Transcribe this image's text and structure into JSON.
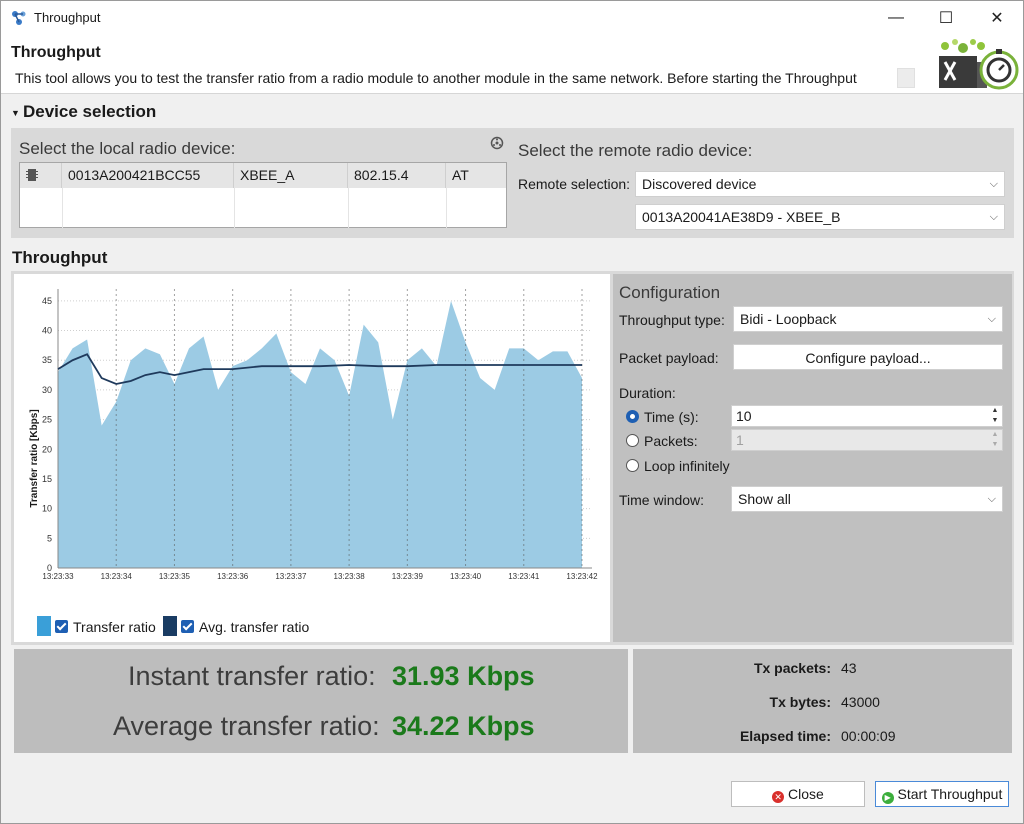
{
  "window": {
    "title": "Throughput",
    "minimize": "—",
    "maximize": "☐",
    "close": "✕"
  },
  "header": {
    "title": "Throughput",
    "description": "This tool allows you to test the transfer ratio from a radio module to another module in the same network. Before starting the Throughput"
  },
  "device_selection": {
    "section_title": "Device selection",
    "local_label": "Select the local radio device:",
    "local_device": {
      "mac": "0013A200421BCC55",
      "name": "XBEE_A",
      "protocol": "802.15.4",
      "mode": "AT"
    },
    "remote_label": "Select the remote radio device:",
    "remote_selection_label": "Remote selection:",
    "remote_selection_value": "Discovered device",
    "remote_device_value": "0013A20041AE38D9 - XBEE_B"
  },
  "throughput": {
    "section_title": "Throughput"
  },
  "chart_data": {
    "type": "area",
    "ylabel": "Transfer ratio [Kbps]",
    "ylim": [
      0,
      47
    ],
    "yticks": [
      "45",
      "40",
      "35",
      "30",
      "25",
      "20",
      "15",
      "10",
      "5",
      "0"
    ],
    "xticks": [
      "13:23:33",
      "13:23:34",
      "13:23:35",
      "13:23:36",
      "13:23:37",
      "13:23:38",
      "13:23:39",
      "13:23:40",
      "13:23:41",
      "13:23:42"
    ],
    "grid": true,
    "series": [
      {
        "name": "Transfer ratio",
        "kind": "area",
        "color": "#9ccbe4",
        "x": [
          0.0,
          0.25,
          0.5,
          0.75,
          1.0,
          1.25,
          1.5,
          1.75,
          2.0,
          2.25,
          2.5,
          2.75,
          3.0,
          3.25,
          3.5,
          3.75,
          4.0,
          4.25,
          4.5,
          4.75,
          5.0,
          5.25,
          5.5,
          5.75,
          6.0,
          6.25,
          6.5,
          6.75,
          7.0,
          7.25,
          7.5,
          7.75,
          8.0,
          8.25,
          8.5,
          8.75,
          9.0
        ],
        "values": [
          33,
          37,
          38.5,
          24,
          28,
          35,
          37,
          36,
          31,
          37,
          39,
          30,
          34,
          35,
          37,
          39.5,
          33,
          31,
          37,
          35,
          29,
          41,
          38,
          25,
          35,
          37,
          34,
          45,
          38,
          32,
          30,
          37,
          37,
          35,
          36.5,
          36.5,
          32
        ]
      },
      {
        "name": "Avg. transfer ratio",
        "kind": "line",
        "color": "#1f3a5c",
        "x": [
          0.0,
          0.25,
          0.5,
          0.75,
          1.0,
          1.25,
          1.5,
          1.75,
          2.0,
          2.25,
          2.5,
          3.0,
          3.5,
          4.0,
          4.5,
          5.0,
          5.5,
          6.0,
          6.5,
          7.0,
          7.5,
          8.0,
          8.5,
          9.0
        ],
        "values": [
          33.5,
          35,
          36,
          32,
          31,
          31.5,
          32.5,
          33,
          32.5,
          33,
          33.5,
          33.5,
          34,
          34,
          34,
          34.2,
          34,
          34,
          34.2,
          34.2,
          34.2,
          34.2,
          34.2,
          34.2
        ]
      }
    ],
    "legend": [
      {
        "label": "Transfer ratio",
        "color": "#3a9fd8"
      },
      {
        "label": "Avg. transfer ratio",
        "color": "#1a3c63"
      }
    ]
  },
  "configuration": {
    "title": "Configuration",
    "throughput_type_label": "Throughput type:",
    "throughput_type_value": "Bidi - Loopback",
    "packet_payload_label": "Packet payload:",
    "configure_payload_button": "Configure payload...",
    "duration_label": "Duration:",
    "time_label": "Time (s):",
    "time_value": "10",
    "packets_label": "Packets:",
    "packets_value": "1",
    "loop_label": "Loop infinitely",
    "time_window_label": "Time window:",
    "time_window_value": "Show all"
  },
  "stats": {
    "instant_label": "Instant transfer ratio:",
    "instant_value": "31.93 Kbps",
    "average_label": "Average transfer ratio:",
    "average_value": "34.22 Kbps",
    "tx_packets_label": "Tx packets:",
    "tx_packets_value": "43",
    "tx_bytes_label": "Tx bytes:",
    "tx_bytes_value": "43000",
    "elapsed_label": "Elapsed time:",
    "elapsed_value": "00:00:09"
  },
  "footer": {
    "close_label": "Close",
    "start_label": "Start Throughput"
  }
}
